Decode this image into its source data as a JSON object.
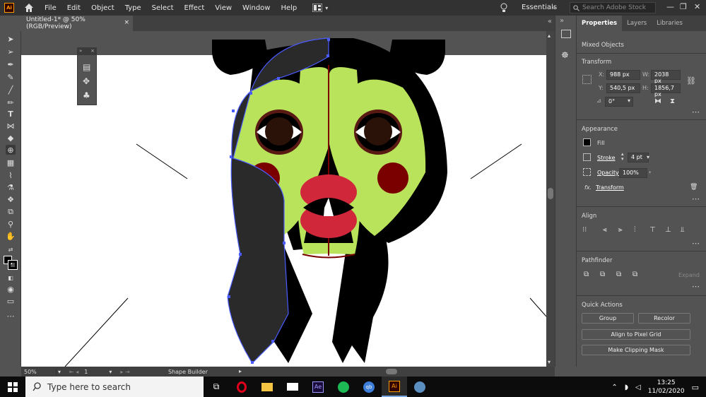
{
  "menubar": {
    "app_icon": "Ai",
    "items": [
      "File",
      "Edit",
      "Object",
      "Type",
      "Select",
      "Effect",
      "View",
      "Window",
      "Help"
    ],
    "workspace": "Essentials",
    "stock_search_placeholder": "Search Adobe Stock"
  },
  "document_tab": {
    "title": "Untitled-1* @ 50% (RGB/Preview)",
    "close": "×"
  },
  "floating_panel": {
    "close": "×",
    "expand": "»"
  },
  "status": {
    "zoom": "50%",
    "artboard": "1",
    "tool": "Shape Builder"
  },
  "panel": {
    "tabs": [
      "Properties",
      "Layers",
      "Libraries"
    ],
    "selection_type": "Mixed Objects",
    "transform": {
      "title": "Transform",
      "x_label": "X:",
      "x": "988 px",
      "y_label": "Y:",
      "y": "540,5 px",
      "w_label": "W:",
      "w": "2038 px",
      "h_label": "H:",
      "h": "1856,7 px",
      "angle": "0°"
    },
    "appearance": {
      "title": "Appearance",
      "fill_label": "Fill",
      "stroke_label": "Stroke",
      "stroke_value": "4 pt",
      "opacity_label": "Opacity",
      "opacity_value": "100%",
      "fx_label": "Transform"
    },
    "align": {
      "title": "Align"
    },
    "pathfinder": {
      "title": "Pathfinder",
      "expand": "Expand"
    },
    "quick_actions": {
      "title": "Quick Actions",
      "group": "Group",
      "recolor": "Recolor",
      "align_pixel": "Align to Pixel Grid",
      "clip_mask": "Make Clipping Mask"
    }
  },
  "taskbar": {
    "search_placeholder": "Type here to search",
    "apps": [
      "task-view",
      "opera",
      "file-explorer",
      "mail",
      "after-effects",
      "spotify",
      "qbittorrent",
      "illustrator",
      "photos"
    ],
    "ae_label": "Ae",
    "qb_label": "qb",
    "ai_label": "Ai",
    "time": "13:25",
    "date": "11/02/2020"
  },
  "colors": {
    "accent": "#ff9a00",
    "face_green": "#b9e35a",
    "cheek": "#7a0000",
    "mouth": "#d0283a",
    "hair": "#000000",
    "selection": "#4a5cff"
  }
}
